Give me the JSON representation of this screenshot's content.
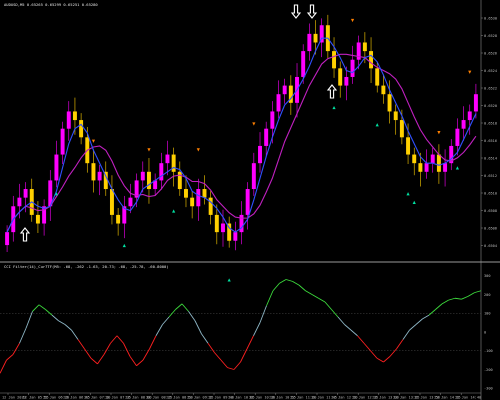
{
  "main_chart": {
    "header_text": "AUDUSD,M5  0.65265 0.65299 0.65251 0.65280",
    "price_labels": [
      "0.6530",
      "0.6528",
      "0.6526",
      "0.6524",
      "0.6522",
      "0.6520",
      "0.6518",
      "0.6516",
      "0.6514",
      "0.6512",
      "0.6510",
      "0.6508",
      "0.6506",
      "0.6504"
    ],
    "bull_color": "#ff00ff",
    "bear_color": "#ffd000",
    "ma_fast_color": "#3050ff",
    "ma_slow_color": "#c020c0",
    "up_arrow_color": "#00e0a0",
    "down_arrow_color": "#ff8000",
    "big_arrow_color": "#ffffff",
    "candle_closes": [
      0.6505,
      0.6508,
      0.6509,
      0.651,
      0.6507,
      0.6506,
      0.6508,
      0.6511,
      0.6514,
      0.6517,
      0.6519,
      0.6518,
      0.6516,
      0.6513,
      0.6511,
      0.6512,
      0.651,
      0.6507,
      0.6506,
      0.6508,
      0.6509,
      0.6511,
      0.6512,
      0.651,
      0.6511,
      0.6513,
      0.6514,
      0.6512,
      0.651,
      0.6509,
      0.6508,
      0.651,
      0.6509,
      0.6507,
      0.6505,
      0.6506,
      0.6504,
      0.6505,
      0.6507,
      0.651,
      0.6513,
      0.6515,
      0.6517,
      0.6519,
      0.6521,
      0.6522,
      0.652,
      0.6523,
      0.6526,
      0.6528,
      0.6527,
      0.6529,
      0.6526,
      0.6524,
      0.6522,
      0.6523,
      0.6525,
      0.6527,
      0.6526,
      0.6524,
      0.6522,
      0.6521,
      0.6519,
      0.6518,
      0.6516,
      0.6514,
      0.6513,
      0.6512,
      0.6513,
      0.6514,
      0.6512,
      0.6513,
      0.6515,
      0.6517,
      0.6518,
      0.6519,
      0.6521
    ]
  },
  "indicator": {
    "header_text": "CCI Filter(14)_Cur7TF(M5: -68, -262 -1.63, 20.73; -68, -25.78, -60.8000)",
    "levels": [
      "300",
      "200",
      "100",
      "0",
      "-100",
      "-200",
      "-300"
    ],
    "bull_color": "#3ddc3d",
    "bear_color": "#ff2020",
    "neutral_color": "#8fb8c8",
    "values": [
      -220,
      -150,
      -120,
      -60,
      20,
      110,
      145,
      120,
      90,
      60,
      40,
      10,
      -40,
      -90,
      -140,
      -170,
      -120,
      -60,
      -20,
      -60,
      -130,
      -180,
      -150,
      -90,
      -20,
      40,
      80,
      120,
      150,
      110,
      60,
      -10,
      -60,
      -110,
      -150,
      -190,
      -200,
      -160,
      -90,
      -20,
      50,
      140,
      220,
      260,
      280,
      270,
      250,
      220,
      200,
      180,
      160,
      120,
      80,
      40,
      10,
      -20,
      -60,
      -100,
      -140,
      -160,
      -130,
      -90,
      -40,
      10,
      40,
      70,
      90,
      120,
      150,
      170,
      180,
      175,
      190,
      210,
      220
    ]
  },
  "time_labels": [
    "12 Jan 2023",
    "12 Jan 05:55",
    "12 Jan 06:20",
    "12 Jan 06:45",
    "12 Jan 07:10",
    "12 Jan 07:35",
    "12 Jan 08:00",
    "12 Jan 08:25",
    "12 Jan 08:50",
    "12 Jan 09:15",
    "12 Jan 09:40",
    "12 Jan 10:05",
    "12 Jan 10:30",
    "12 Jan 10:55",
    "12 Jan 11:20",
    "12 Jan 11:45",
    "12 Jan 12:10",
    "12 Jan 12:35",
    "12 Jan 13:00",
    "12 Jan 13:25",
    "12 Jan 13:50",
    "12 Jan 14:15",
    "12 Jan 14:40"
  ]
}
